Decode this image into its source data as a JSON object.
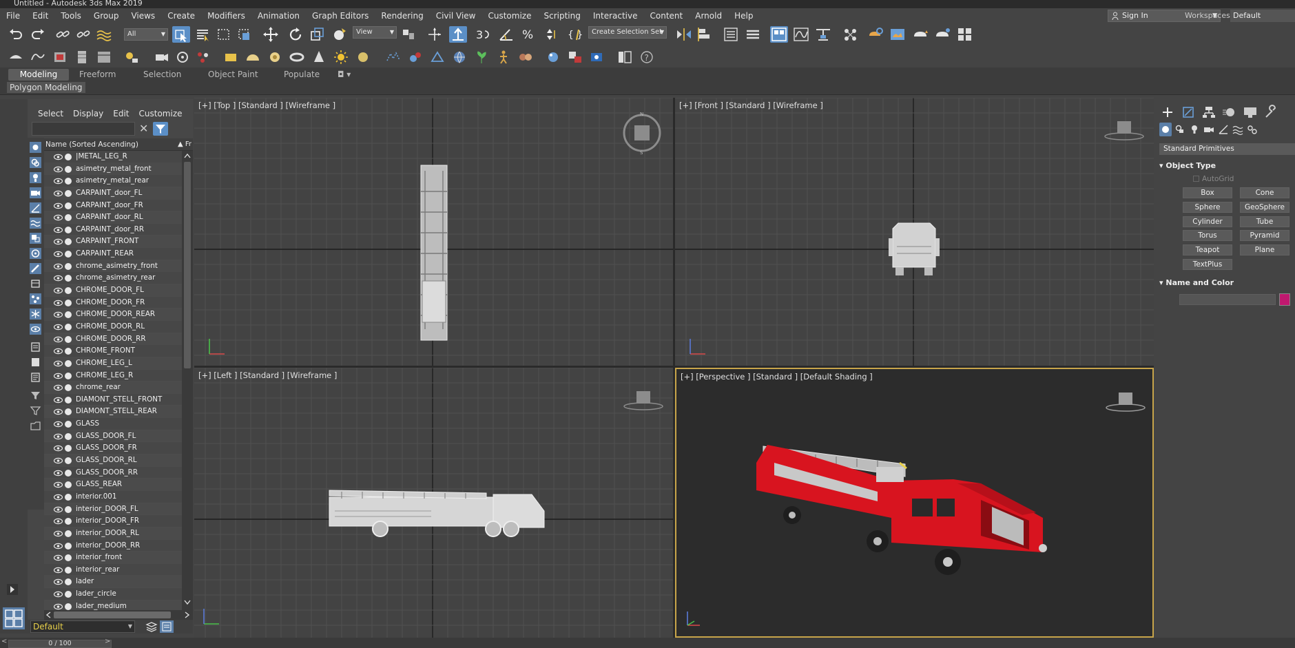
{
  "window": {
    "title": "Untitled - Autodesk 3ds Max 2019"
  },
  "menu": [
    "File",
    "Edit",
    "Tools",
    "Group",
    "Views",
    "Create",
    "Modifiers",
    "Animation",
    "Graph Editors",
    "Rendering",
    "Civil View",
    "Customize",
    "Scripting",
    "Interactive",
    "Content",
    "Arnold",
    "Help"
  ],
  "account": {
    "sign_in": "Sign In",
    "workspaces_label": "Workspaces:",
    "workspace": "Default"
  },
  "toolbar": {
    "selection_filter": "All",
    "ref_coord": "View",
    "named_selection": "Create Selection Set"
  },
  "ribbon": {
    "tabs": [
      "Modeling",
      "Freeform",
      "Selection",
      "Object Paint",
      "Populate"
    ],
    "panel_label": "Polygon Modeling"
  },
  "scene_explorer": {
    "menu": [
      "Select",
      "Display",
      "Edit",
      "Customize"
    ],
    "column_header": "Name (Sorted Ascending)",
    "column_header_right": "▲ Fr",
    "objects": [
      "|METAL_LEG_R",
      "asimetry_metal_front",
      "asimetry_metal_rear",
      "CARPAINT_door_FL",
      "CARPAINT_door_FR",
      "CARPAINT_door_RL",
      "CARPAINT_door_RR",
      "CARPAINT_FRONT",
      "CARPAINT_REAR",
      "chrome_asimetry_front",
      "chrome_asimetry_rear",
      "CHROME_DOOR_FL",
      "CHROME_DOOR_FR",
      "CHROME_DOOR_REAR",
      "CHROME_DOOR_RL",
      "CHROME_DOOR_RR",
      "CHROME_FRONT",
      "CHROME_LEG_L",
      "CHROME_LEG_R",
      "chrome_rear",
      "DIAMONT_STELL_FRONT",
      "DIAMONT_STELL_REAR",
      "GLASS",
      "GLASS_DOOR_FL",
      "GLASS_DOOR_FR",
      "GLASS_DOOR_RL",
      "GLASS_DOOR_RR",
      "GLASS_REAR",
      "interior.001",
      "interior_DOOR_FL",
      "interior_DOOR_FR",
      "interior_DOOR_RL",
      "interior_DOOR_RR",
      "interior_front",
      "interior_rear",
      "lader",
      "lader_circle",
      "lader_medium"
    ],
    "layer": "Default"
  },
  "viewports": {
    "top": "[+] [Top ] [Standard ] [Wireframe ]",
    "front": "[+] [Front ] [Standard ] [Wireframe ]",
    "left": "[+] [Left ] [Standard ] [Wireframe ]",
    "perspective": "[+] [Perspective ] [Standard ] [Default Shading ]"
  },
  "command_panel": {
    "category": "Standard Primitives",
    "object_type_title": "Object Type",
    "autogrid": "AutoGrid",
    "buttons": [
      "Box",
      "Cone",
      "Sphere",
      "GeoSphere",
      "Cylinder",
      "Tube",
      "Torus",
      "Pyramid",
      "Teapot",
      "Plane",
      "TextPlus"
    ],
    "name_color_title": "Name and Color",
    "object_color": "#c0186f"
  },
  "timeline": {
    "frame": "0 / 100"
  },
  "colors": {
    "accent": "#5b8fc7",
    "active_viewport": "#c8a54a",
    "truck_red": "#d8141f"
  }
}
